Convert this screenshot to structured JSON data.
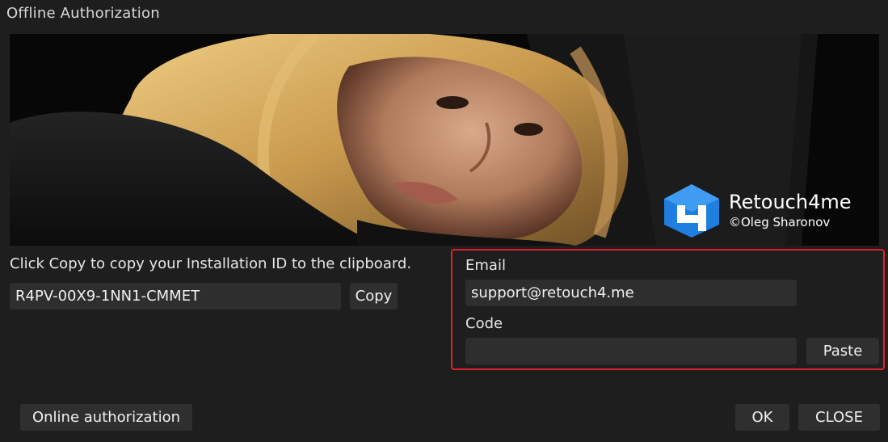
{
  "window": {
    "title": "Offline Authorization"
  },
  "banner": {
    "brand_name": "Retouch4me",
    "brand_copyright": "©Oleg Sharonov",
    "brand_color": "#1e7fe0"
  },
  "installation": {
    "instruction": "Click Copy to copy your Installation ID to the clipboard.",
    "id_value": "R4PV-00X9-1NN1-CMMET",
    "copy_label": "Copy"
  },
  "credentials": {
    "email_label": "Email",
    "email_value": "support@retouch4.me",
    "code_label": "Code",
    "code_value": "",
    "paste_label": "Paste"
  },
  "footer": {
    "online_label": "Online authorization",
    "ok_label": "OK",
    "close_label": "CLOSE"
  },
  "colors": {
    "background": "#1e1e1e",
    "field": "#2e2e2e",
    "highlight": "#e0202a"
  }
}
